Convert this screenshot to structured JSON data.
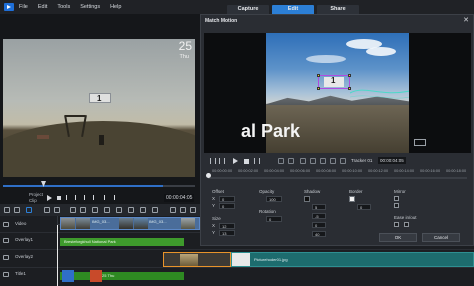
{
  "menu": {
    "items": [
      "File",
      "Edit",
      "Tools",
      "Settings",
      "Help"
    ],
    "tabs": [
      {
        "label": "Capture",
        "active": false
      },
      {
        "label": "Edit",
        "active": true
      },
      {
        "label": "Share",
        "active": false
      }
    ]
  },
  "preview": {
    "date_number": "25",
    "date_day": "Thu",
    "sticker_text": "1",
    "mode_project": "Project",
    "mode_clip": "Clip",
    "timecode": "00:00:04:05"
  },
  "dialog": {
    "title": "Match Motion",
    "close_glyph": "✕",
    "title_overlay": "al Park",
    "sticker_text": "1",
    "tracker_label": "Tracker 01",
    "timecode": "00:00:04:05",
    "ruler": [
      "00:00:00:00",
      "00:00:02:00",
      "00:00:04:00",
      "00:00:06:00",
      "00:00:08:00",
      "00:00:10:00",
      "00:00:12:00",
      "00:00:14:00",
      "00:00:16:00",
      "00:00:18:00"
    ],
    "props": {
      "offset_label": "Offset",
      "offset_x": "0",
      "offset_y": "0",
      "opacity_label": "Opacity",
      "opacity_value": "100",
      "shadow_label": "Shadow",
      "border_label": "Border",
      "border_value": "0",
      "mirror_label": "Mirror",
      "size_label": "Size",
      "size_x": "12",
      "size_y": "13",
      "rotation_label": "Rotation",
      "rotation_value": "0",
      "shadow_x": "5",
      "shadow_y": "-5",
      "shadow_blur": "0",
      "shadow_opacity": "40",
      "ease_label": "Ease in/out"
    },
    "ok_label": "OK",
    "cancel_label": "Cancel"
  },
  "timeline": {
    "ruler": [
      "00:00:00:00",
      "00:00:02:04",
      "00:00:04:04",
      "00:00:06:00"
    ],
    "tracks": [
      {
        "name": "Video"
      },
      {
        "name": "Overlay1"
      },
      {
        "name": "Overlay2"
      },
      {
        "name": "Title1"
      }
    ],
    "clips": {
      "video_labels": [
        "IMG_03...",
        "IMG_03..."
      ],
      "overlay1_title": "Bresteforgkhull National Park",
      "overlay2_image": "Picturehoder01.jpg",
      "title1_text": "25 Thu"
    }
  },
  "colors": {
    "accent": "#2c7fd6",
    "title_clip": "#3e9a2c",
    "image_clip": "#1d6c6e",
    "selection": "#e8932a",
    "tracker_box": "#b04de0"
  }
}
